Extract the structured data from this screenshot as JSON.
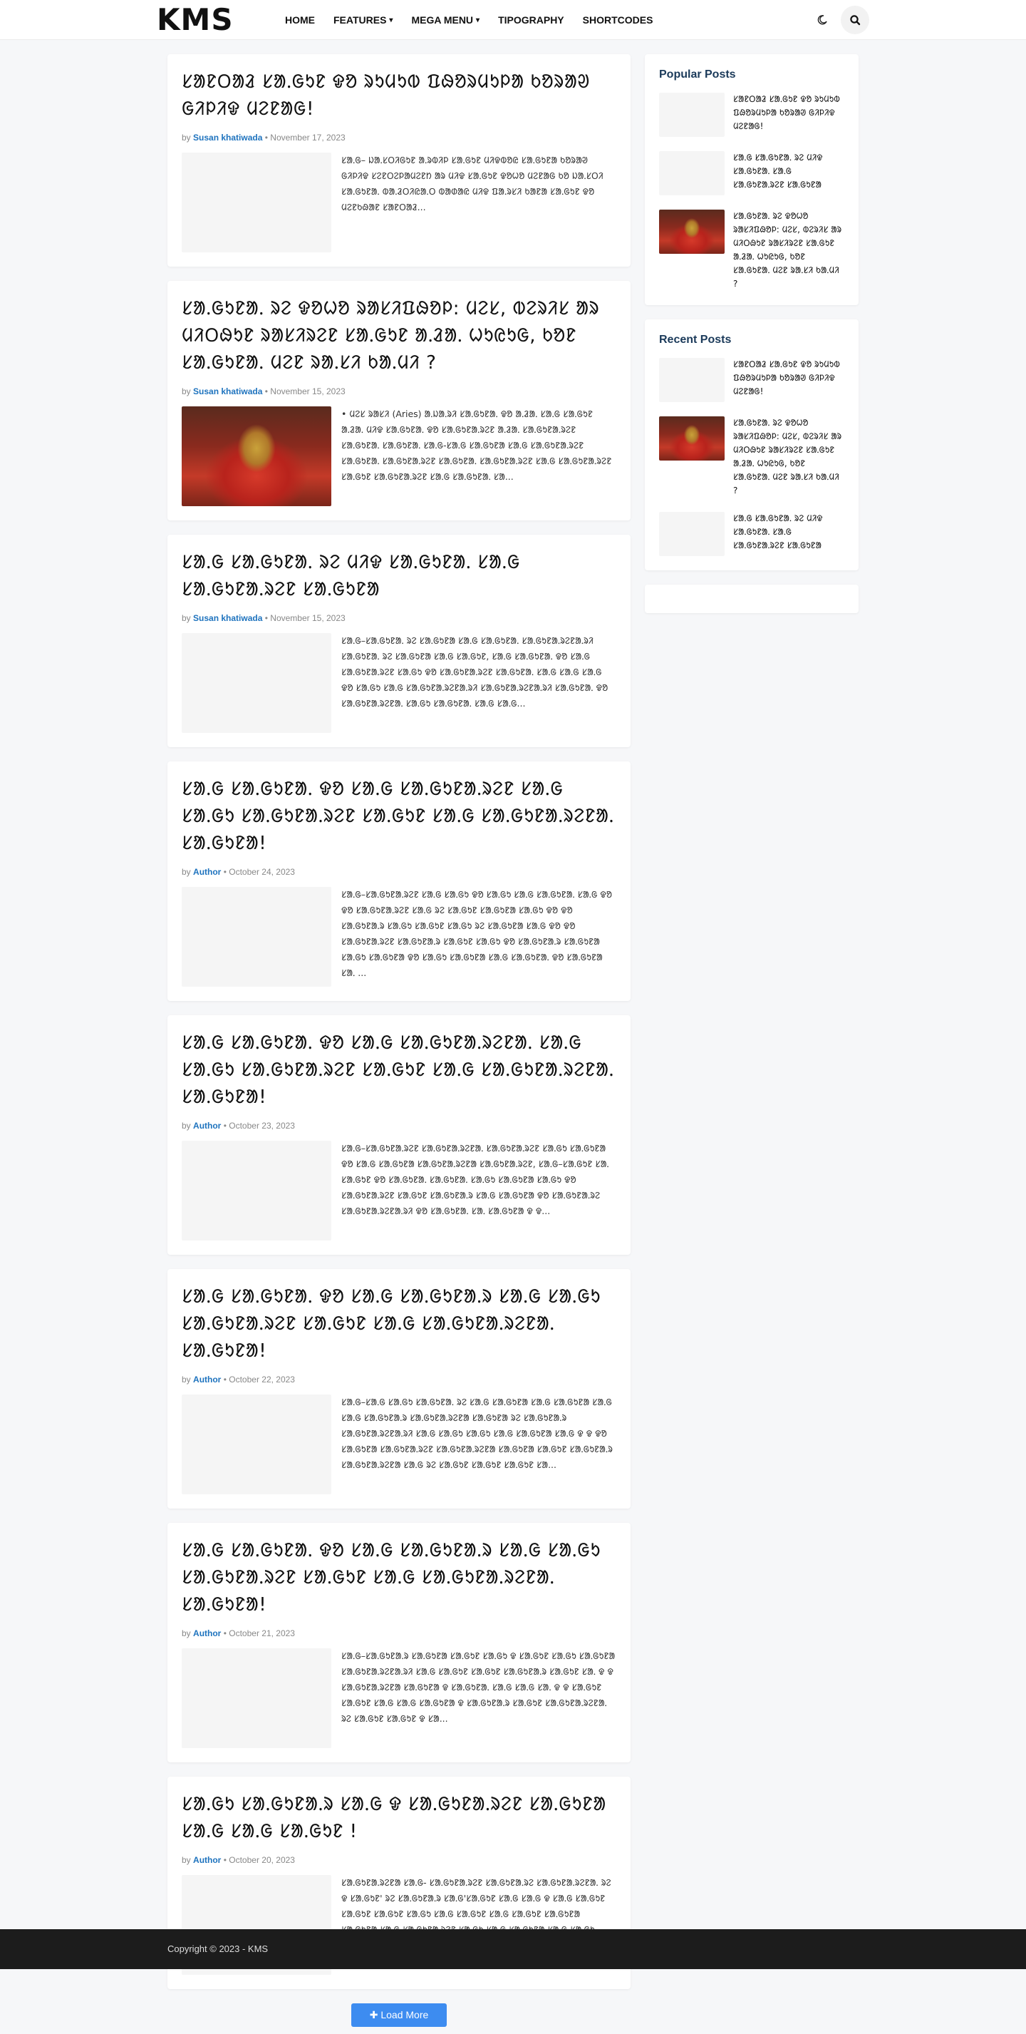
{
  "header": {
    "logo": "KMS",
    "nav": [
      {
        "label": "HOME",
        "dropdown": false
      },
      {
        "label": "FEATURES",
        "dropdown": true
      },
      {
        "label": "MEGA MENU",
        "dropdown": true
      },
      {
        "label": "TIPOGRAPHY",
        "dropdown": false
      },
      {
        "label": "SHORTCODES",
        "dropdown": false
      }
    ],
    "icons": {
      "theme": "moon-icon",
      "search": "search-icon"
    }
  },
  "posts": [
    {
      "title": "ᱥᱟᱱᱛᱟᱲ ᱥᱟᱹᱜᱩᱱ ᱫᱚ ᱨᱩᱢᱩᱵ ᱯᱷᱚᱨᱢᱩᱞᱟ ᱠᱚᱨᱟᱣ ᱜᱤᱞᱤᱫ ᱢᱮᱱᱟᱜ!",
      "by": "by",
      "author": "Susan khatiwada",
      "date": "November 17, 2023",
      "has_image": false,
      "excerpt": "ᱥᱟᱹᱜ– ᱡᱟᱹᱥᱛᱤᱜᱩᱱ ᱟᱹᱨᱵᱤᱞ ᱥᱟᱹᱜᱩᱱ ᱢᱤᱫᱵᱚᱭ ᱥᱟᱹᱜᱩᱱᱟ ᱠᱚᱨᱟᱣ ᱜᱤᱞᱤᱫ ᱥᱮᱱᱛᱮᱞᱟᱢᱮᱱᱴ ᱟᱨ ᱢᱤᱫ ᱥᱟᱹᱜᱩᱱ ᱫᱚᱦᱚ ᱢᱮᱱᱟᱜ ᱠᱚ ᱡᱟᱹᱥᱛᱤ ᱥᱟᱹᱜᱩᱱᱟᱹ ᱵᱟᱹᱲᱛᱤᱭᱟᱹᱛ ᱵᱟᱰᱟᱭ ᱢᱤᱫ ᱯᱟᱹᱨᱥᱤ ᱠᱟᱱᱟ ᱥᱟᱹᱜᱩᱱ ᱫᱚ ᱢᱮᱱᱠᱷᱟᱱ ᱥᱟᱱᱛᱟᱲ..."
    },
    {
      "title": "ᱥᱟᱹᱜᱩᱱᱟᱹ ᱨᱮ ᱫᱚᱦᱚ ᱨᱟᱥᱤᱯᱷᱚᱞ: ᱢᱮᱥ, ᱵᱮᱨᱤᱥ ᱟᱨ ᱢᱤᱛᱷᱩᱱ ᱨᱟᱥᱤᱨᱮᱱ ᱥᱟᱹᱜᱩᱱ ᱟᱹᱲᱟᱹ ᱦᱩᱭᱩᱜ, ᱠᱚᱱ ᱥᱟᱹᱜᱩᱱᱟᱹ ᱢᱮᱱ ᱨᱟᱹᱥᱤ ᱠᱟᱹᱢᱤ ?",
      "by": "by",
      "author": "Susan khatiwada",
      "date": "November 15, 2023",
      "has_image": true,
      "excerpt": "• ᱢᱮᱥ ᱨᱟᱥᱤ (Aries) ᱟᱹᱡᱟᱹᱨᱤ ᱥᱟᱹᱜᱩᱱᱟᱹ ᱫᱚ ᱟᱹᱲᱟᱹ ᱥᱟᱹᱜ ᱥᱟᱹᱜᱩᱱ ᱟᱹᱲᱟᱹ ᱢᱤᱫ ᱥᱟᱹᱜᱩᱱᱟᱹ ᱫᱚ ᱥᱟᱹᱜᱩᱱᱟᱹᱨᱮᱱ ᱟᱹᱲᱟᱹ ᱥᱟᱹᱜᱩᱱᱟᱹᱨᱮᱱ ᱥᱟᱹᱜᱩᱱᱟᱹ ᱥᱟᱹᱜᱩᱱᱟᱹ ᱥᱟᱹᱜ-ᱥᱟᱹᱜ ᱥᱟᱹᱜᱩᱱᱟ ᱥᱟᱹᱜ ᱥᱟᱹᱜᱩᱱᱟᱹᱨᱮᱱ ᱥᱟᱹᱜᱩᱱᱟᱹ ᱥᱟᱹᱜᱩᱱᱟᱹᱨᱮᱱ ᱥᱟᱹᱜᱩᱱᱟᱹ ᱥᱟᱹᱜᱩᱱᱟᱹᱨᱮᱱ ᱥᱟᱹᱜ ᱥᱟᱹᱜᱩᱱᱟᱹᱨᱮᱱ ᱥᱟᱹᱜᱩᱱ ᱥᱟᱹᱜᱩᱱᱟᱹᱨᱮᱱ ᱥᱟᱹᱜ ᱥᱟᱹᱜᱩᱱᱟᱹ ᱥᱟ..."
    },
    {
      "title": "ᱥᱟᱹᱜ ᱥᱟᱹᱜᱩᱱᱟᱹ ᱨᱮ ᱢᱤᱫ ᱥᱟᱹᱜᱩᱱᱟᱹ ᱥᱟᱹᱜ ᱥᱟᱹᱜᱩᱱᱟᱹᱨᱮᱱ ᱥᱟᱹᱜᱩᱱᱟ",
      "by": "by",
      "author": "Susan khatiwada",
      "date": "November 15, 2023",
      "has_image": false,
      "excerpt": "ᱥᱟᱹᱜ–ᱥᱟᱹᱜᱩᱱᱟᱹ ᱨᱮ ᱥᱟᱹᱜᱩᱱᱟ ᱥᱟᱹᱜ ᱥᱟᱹᱜᱩᱱᱟᱹ ᱥᱟᱹᱜᱩᱱᱟᱹᱨᱮᱱᱟᱹᱨᱤ ᱥᱟᱹᱜᱩᱱᱟᱹ ᱨᱮ ᱥᱟᱹᱜᱩᱱᱟ ᱥᱟᱹᱜ ᱥᱟᱹᱜᱩᱱ, ᱥᱟᱹᱜ ᱥᱟᱹᱜᱩᱱᱟᱹ ᱫᱚ ᱥᱟᱹᱜ ᱥᱟᱹᱜᱩᱱᱟᱹᱨᱮᱱ ᱥᱟᱹᱜᱩ ᱫᱚ ᱥᱟᱹᱜᱩᱱᱟᱹᱨᱮᱱ ᱥᱟᱹᱜᱩᱱᱟᱹ ᱥᱟᱹᱜ ᱥᱟᱹᱜ ᱥᱟᱹᱜ ᱫᱚ ᱥᱟᱹᱜᱩ ᱥᱟᱹᱜ ᱥᱟᱹᱜᱩᱱᱟᱹᱨᱮᱱᱟᱹᱨᱤ ᱥᱟᱹᱜᱩᱱᱟᱹᱨᱮᱱᱟᱹᱨᱤ ᱥᱟᱹᱜᱩᱱᱟᱹ ᱫᱚ ᱥᱟᱹᱜᱩᱱᱟᱹᱨᱮᱱᱟᱹ ᱥᱟᱹᱜᱩ ᱥᱟᱹᱜᱩᱱᱟᱹ ᱥᱟᱹᱜ ᱥᱟᱹᱜ..."
    },
    {
      "title": "ᱥᱟᱹᱜ ᱥᱟᱹᱜᱩᱱᱟᱹ ᱫᱚ ᱥᱟᱹᱜ ᱥᱟᱹᱜᱩᱱᱟᱹᱨᱮᱱ ᱥᱟᱹᱜ ᱥᱟᱹᱜᱩ ᱥᱟᱹᱜᱩᱱᱟᱹᱨᱮᱱ ᱥᱟᱹᱜᱩᱱ ᱥᱟᱹᱜ ᱥᱟᱹᱜᱩᱱᱟᱹᱨᱮᱱᱟᱹ ᱥᱟᱹᱜᱩᱱᱟ!",
      "by": "by",
      "author": "Author",
      "date": "October 24, 2023",
      "has_image": false,
      "excerpt": "ᱥᱟᱹᱜ–ᱥᱟᱹᱜᱩᱱᱟᱹᱨᱮᱱ ᱥᱟᱹᱜ ᱥᱟᱹᱜᱩ ᱫᱚ ᱥᱟᱹᱜᱩ ᱥᱟᱹᱜ ᱥᱟᱹᱜᱩᱱᱟᱹ ᱥᱟᱹᱜ ᱫᱚ ᱫᱚ ᱥᱟᱹᱜᱩᱱᱟᱹᱨᱮᱱ ᱥᱟᱹᱜ ᱨᱮ ᱥᱟᱹᱜᱩᱱ ᱥᱟᱹᱜᱩᱱᱟ ᱥᱟᱹᱜᱩ ᱫᱚ ᱫᱚ ᱥᱟᱹᱜᱩᱱᱟᱹᱨ ᱥᱟᱹᱜᱩ ᱥᱟᱹᱜᱩᱱ ᱥᱟᱹᱜᱩ ᱨᱮ ᱥᱟᱹᱜᱩᱱᱟ ᱥᱟᱹᱜ ᱫᱚ ᱫᱚ ᱥᱟᱹᱜᱩᱱᱟᱹᱨᱮᱱ ᱥᱟᱹᱜᱩᱱᱟᱹᱨ ᱥᱟᱹᱜᱩᱱ ᱥᱟᱹᱜᱩ ᱫᱚ ᱥᱟᱹᱜᱩᱱᱟᱹᱨ ᱥᱟᱹᱜᱩᱱᱟ ᱥᱟᱹᱜᱩ ᱥᱟᱹᱜᱩᱱᱟ ᱫᱚ ᱥᱟᱹᱜᱩ ᱥᱟᱹᱜᱩᱱᱟ ᱥᱟᱹᱜ ᱥᱟᱹᱜᱩᱱᱟᱹ ᱫᱚ ᱥᱟᱹᱜᱩᱱᱟ ᱥᱟᱹ ..."
    },
    {
      "title": "ᱥᱟᱹᱜ ᱥᱟᱹᱜᱩᱱᱟᱹ ᱫᱚ ᱥᱟᱹᱜ ᱥᱟᱹᱜᱩᱱᱟᱹᱨᱮᱱᱟᱹ ᱥᱟᱹᱜ ᱥᱟᱹᱜᱩ ᱥᱟᱹᱜᱩᱱᱟᱹᱨᱮᱱ ᱥᱟᱹᱜᱩᱱ ᱥᱟᱹᱜ ᱥᱟᱹᱜᱩᱱᱟᱹᱨᱮᱱᱟᱹ ᱥᱟᱹᱜᱩᱱᱟ!",
      "by": "by",
      "author": "Author",
      "date": "October 23, 2023",
      "has_image": false,
      "excerpt": "ᱥᱟᱹᱜ–ᱥᱟᱹᱜᱩᱱᱟᱹᱨᱮᱱ ᱥᱟᱹᱜᱩᱱᱟᱹᱨᱮᱱᱟᱹ ᱥᱟᱹᱜᱩᱱᱟᱹᱨᱮᱱ ᱥᱟᱹᱜᱩ ᱥᱟᱹᱜᱩᱱᱟ ᱫᱚ ᱥᱟᱹᱜ ᱥᱟᱹᱜᱩᱱᱟ ᱥᱟᱹᱜᱩᱱᱟᱹᱨᱮᱱᱟ ᱥᱟᱹᱜᱩᱱᱟᱹᱨᱮᱱ, ᱥᱟᱹᱜ–ᱥᱟᱹᱜᱩᱱ ᱥᱟᱹ ᱥᱟᱹᱜᱩᱱ ᱫᱚ ᱥᱟᱹᱜᱩᱱᱟᱹ ᱥᱟᱹᱜᱩᱱᱟᱹ ᱥᱟᱹᱜᱩ ᱥᱟᱹᱜᱩᱱᱟ ᱥᱟᱹᱜᱩ ᱫᱚ ᱥᱟᱹᱜᱩᱱᱟᱹᱨᱮᱱ ᱥᱟᱹᱜᱩᱱ ᱥᱟᱹᱜᱩᱱᱟᱹᱨ ᱥᱟᱹᱜ ᱥᱟᱹᱜᱩᱱᱟ ᱫᱚ ᱥᱟᱹᱜᱩᱱᱟᱹᱨᱮ ᱥᱟᱹᱜᱩᱱᱟᱹᱨᱮᱱᱟᱹᱨᱤ ᱫᱚ ᱥᱟᱹᱜᱩᱱᱟᱹ ᱥᱟᱹ ᱥᱟᱹᱜᱩᱱᱟ ᱫ ᱫ..."
    },
    {
      "title": "ᱥᱟᱹᱜ ᱥᱟᱹᱜᱩᱱᱟᱹ ᱫᱚ ᱥᱟᱹᱜ ᱥᱟᱹᱜᱩᱱᱟᱹᱨ ᱥᱟᱹᱜ ᱥᱟᱹᱜᱩ ᱥᱟᱹᱜᱩᱱᱟᱹᱨᱮᱱ ᱥᱟᱹᱜᱩᱱ ᱥᱟᱹᱜ ᱥᱟᱹᱜᱩᱱᱟᱹᱨᱮᱱᱟᱹ ᱥᱟᱹᱜᱩᱱᱟ!",
      "by": "by",
      "author": "Author",
      "date": "October 22, 2023",
      "has_image": false,
      "excerpt": "ᱥᱟᱹᱜ–ᱥᱟᱹᱜ ᱥᱟᱹᱜᱩ ᱥᱟᱹᱜᱩᱱᱟᱹ ᱨᱮ ᱥᱟᱹᱜ ᱥᱟᱹᱜᱩᱱᱟ ᱥᱟᱹᱜ ᱥᱟᱹᱜᱩᱱᱟ ᱥᱟᱹᱜ ᱥᱟᱹᱜ ᱥᱟᱹᱜᱩᱱᱟᱹᱨ ᱥᱟᱹᱜᱩᱱᱟᱹᱨᱮᱱᱟ ᱥᱟᱹᱜᱩᱱᱟ ᱨᱮ ᱥᱟᱹᱜᱩᱱᱟᱹᱨ ᱥᱟᱹᱜᱩᱱᱟᱹᱨᱮᱱᱟᱹᱨᱤ ᱥᱟᱹᱜ ᱥᱟᱹᱜᱩ ᱥᱟᱹᱜᱩ ᱥᱟᱹᱜ ᱥᱟᱹᱜᱩᱱᱟ ᱥᱟᱹᱜ ᱫ ᱫ ᱫᱚ ᱥᱟᱹᱜᱩᱱᱟ ᱥᱟᱹᱜᱩᱱᱟᱹᱨᱮᱱ ᱥᱟᱹᱜᱩᱱᱟᱹᱨᱮᱱᱟ ᱥᱟᱹᱜᱩᱱᱟ ᱥᱟᱹᱜᱩᱱ ᱥᱟᱹᱜᱩᱱᱟᱹᱨ ᱥᱟᱹᱜᱩᱱᱟᱹᱨᱮᱱᱟ ᱥᱟᱹᱜ ᱨᱮ ᱥᱟᱹᱜᱩᱱ ᱥᱟᱹᱜᱩᱱ ᱥᱟᱹᱜᱩᱱ ᱥᱟ..."
    },
    {
      "title": "ᱥᱟᱹᱜ ᱥᱟᱹᱜᱩᱱᱟᱹ ᱫᱚ ᱥᱟᱹᱜ ᱥᱟᱹᱜᱩᱱᱟᱹᱨ ᱥᱟᱹᱜ ᱥᱟᱹᱜᱩ ᱥᱟᱹᱜᱩᱱᱟᱹᱨᱮᱱ ᱥᱟᱹᱜᱩᱱ ᱥᱟᱹᱜ ᱥᱟᱹᱜᱩᱱᱟᱹᱨᱮᱱᱟᱹ ᱥᱟᱹᱜᱩᱱᱟ!",
      "by": "by",
      "author": "Author",
      "date": "October 21, 2023",
      "has_image": false,
      "excerpt": "ᱥᱟᱹᱜ–ᱥᱟᱹᱜᱩᱱᱟᱹᱨ ᱥᱟᱹᱜᱩᱱᱟ ᱥᱟᱹᱜᱩᱱ ᱥᱟᱹᱜᱩ ᱫ ᱥᱟᱹᱜᱩᱱ ᱥᱟᱹᱜᱩ ᱥᱟᱹᱜᱩᱱᱟ ᱥᱟᱹᱜᱩᱱᱟᱹᱨᱮᱱᱟᱹᱨᱤ ᱥᱟᱹᱜ ᱥᱟᱹᱜᱩᱱ ᱥᱟᱹᱜᱩᱱ ᱥᱟᱹᱜᱩᱱᱟᱹᱨ ᱥᱟᱹᱜᱩᱱ ᱥᱟᱹ ᱫ ᱫ ᱥᱟᱹᱜᱩᱱᱟᱹᱨᱮᱱᱟ ᱥᱟᱹᱜᱩᱱᱟ ᱫ ᱥᱟᱹᱜᱩᱱᱟᱹ ᱥᱟᱹᱜ ᱥᱟᱹᱜ ᱥᱟᱹ ᱫ ᱫ ᱥᱟᱹᱜᱩᱱ ᱥᱟᱹᱜᱩᱱ ᱥᱟᱹᱜ ᱥᱟᱹᱜ ᱥᱟᱹᱜᱩᱱᱟ ᱫ ᱥᱟᱹᱜᱩᱱᱟᱹᱨ ᱥᱟᱹᱜᱩᱱ ᱥᱟᱹᱜᱩᱱᱟᱹᱨᱮᱱᱟᱹ ᱨᱮ ᱥᱟᱹᱜᱩᱱ ᱥᱟᱹᱜᱩᱱ ᱫ ᱥᱟ..."
    },
    {
      "title": "ᱥᱟᱹᱜᱩ ᱥᱟᱹᱜᱩᱱᱟᱹᱨ ᱥᱟᱹᱜ ᱫ ᱥᱟᱹᱜᱩᱱᱟᱹᱨᱮᱱ ᱥᱟᱹᱜᱩᱱᱟ ᱥᱟᱹᱜ ᱥᱟᱹᱜ ᱥᱟᱹᱜᱩᱱ !",
      "by": "by",
      "author": "Author",
      "date": "October 20, 2023",
      "has_image": false,
      "excerpt": "ᱥᱟᱹᱜᱩᱱᱟᱹᱨᱮᱱᱟ ᱥᱟᱹᱜ- ᱥᱟᱹᱜᱩᱱᱟᱹᱨᱮᱱ ᱥᱟᱹᱜᱩᱱᱟᱹᱨᱮ ᱥᱟᱹᱜᱩᱱᱟᱹᱨᱮᱱᱟᱹ ᱨᱮ ᱫ ᱥᱟᱹᱜᱩᱱ' ᱨᱮ ᱥᱟᱹᱜᱩᱱᱟᱹᱨ ᱥᱟᱹᱜ'ᱥᱟᱹᱜᱩᱱ ᱥᱟᱹᱜ ᱥᱟᱹᱜ ᱫ ᱥᱟᱹᱜ ᱥᱟᱹᱜᱩᱱ ᱥᱟᱹᱜᱩᱱ ᱥᱟᱹᱜᱩᱱ ᱥᱟᱹᱜᱩ ᱥᱟᱹᱜ ᱥᱟᱹᱜᱩᱱ ᱥᱟᱹᱜ ᱥᱟᱹᱜᱩᱱ ᱥᱟᱹᱜᱩᱱᱟ ᱥᱟᱹᱜᱩᱱᱟ ᱥᱟᱹᱜ ᱥᱟᱹᱜᱩᱱᱟᱹᱨᱮᱱ ᱥᱟᱹᱜᱩ ᱥᱟᱹᱜ ᱥᱟᱹᱜᱩᱱᱟ ᱥᱟᱹᱜ ᱥᱟᱹᱜᱩ ᱨᱮ'ᱥᱟᱹᱜᱩᱱ'ᱨᱮ ᱥᱟᱹᱜᱩ ᱥᱟᱹᱜᱩᱱᱟ ᱥᱟᱹ ᱥᱟ..."
    }
  ],
  "load_more": {
    "label": "Load More",
    "icon": "plus-icon"
  },
  "sidebar": {
    "popular": {
      "title": "Popular Posts",
      "items": [
        {
          "title": "ᱥᱟᱱᱛᱟᱲ ᱥᱟᱹᱜᱩᱱ ᱫᱚ ᱨᱩᱢᱩᱵ ᱯᱷᱚᱨᱢᱩᱞᱟ ᱠᱚᱨᱟᱣ ᱜᱤᱞᱤᱫ ᱢᱮᱱᱟᱜ!",
          "has_image": false
        },
        {
          "title": "ᱥᱟᱹᱜ ᱥᱟᱹᱜᱩᱱᱟᱹ ᱨᱮ ᱢᱤᱫ ᱥᱟᱹᱜᱩᱱᱟᱹ ᱥᱟᱹᱜ ᱥᱟᱹᱜᱩᱱᱟᱹᱨᱮᱱ ᱥᱟᱹᱜᱩᱱᱟ",
          "has_image": false
        },
        {
          "title": "ᱥᱟᱹᱜᱩᱱᱟᱹ ᱨᱮ ᱫᱚᱦᱚ ᱨᱟᱥᱤᱯᱷᱚᱞ: ᱢᱮᱥ, ᱵᱮᱨᱤᱥ ᱟᱨ ᱢᱤᱛᱷᱩᱱ ᱨᱟᱥᱤᱨᱮᱱ ᱥᱟᱹᱜᱩᱱ ᱟᱹᱲᱟᱹ ᱦᱩᱭᱩᱜ, ᱠᱚᱱ ᱥᱟᱹᱜᱩᱱᱟᱹ ᱢᱮᱱ ᱨᱟᱹᱥᱤ ᱠᱟᱹᱢᱤ ?",
          "has_image": true
        }
      ]
    },
    "recent": {
      "title": "Recent Posts",
      "items": [
        {
          "title": "ᱥᱟᱱᱛᱟᱲ ᱥᱟᱹᱜᱩᱱ ᱫᱚ ᱨᱩᱢᱩᱵ ᱯᱷᱚᱨᱢᱩᱞᱟ ᱠᱚᱨᱟᱣ ᱜᱤᱞᱤᱫ ᱢᱮᱱᱟᱜ!",
          "has_image": false
        },
        {
          "title": "ᱥᱟᱹᱜᱩᱱᱟᱹ ᱨᱮ ᱫᱚᱦᱚ ᱨᱟᱥᱤᱯᱷᱚᱞ: ᱢᱮᱥ, ᱵᱮᱨᱤᱥ ᱟᱨ ᱢᱤᱛᱷᱩᱱ ᱨᱟᱥᱤᱨᱮᱱ ᱥᱟᱹᱜᱩᱱ ᱟᱹᱲᱟᱹ ᱦᱩᱭᱩᱜ, ᱠᱚᱱ ᱥᱟᱹᱜᱩᱱᱟᱹ ᱢᱮᱱ ᱨᱟᱹᱥᱤ ᱠᱟᱹᱢᱤ ?",
          "has_image": true
        },
        {
          "title": "ᱥᱟᱹᱜ ᱥᱟᱹᱜᱩᱱᱟᱹ ᱨᱮ ᱢᱤᱫ ᱥᱟᱹᱜᱩᱱᱟᱹ ᱥᱟᱹᱜ ᱥᱟᱹᱜᱩᱱᱟᱹᱨᱮᱱ ᱥᱟᱹᱜᱩᱱᱟ",
          "has_image": false
        }
      ]
    }
  },
  "footer": {
    "copyright": "Copyright © 2023 - KMS"
  },
  "colors": {
    "accent": "#1e73be",
    "button": "#3d8cf0",
    "footer_bg": "#1c1c1c",
    "widget_title": "#1b3a5a"
  }
}
